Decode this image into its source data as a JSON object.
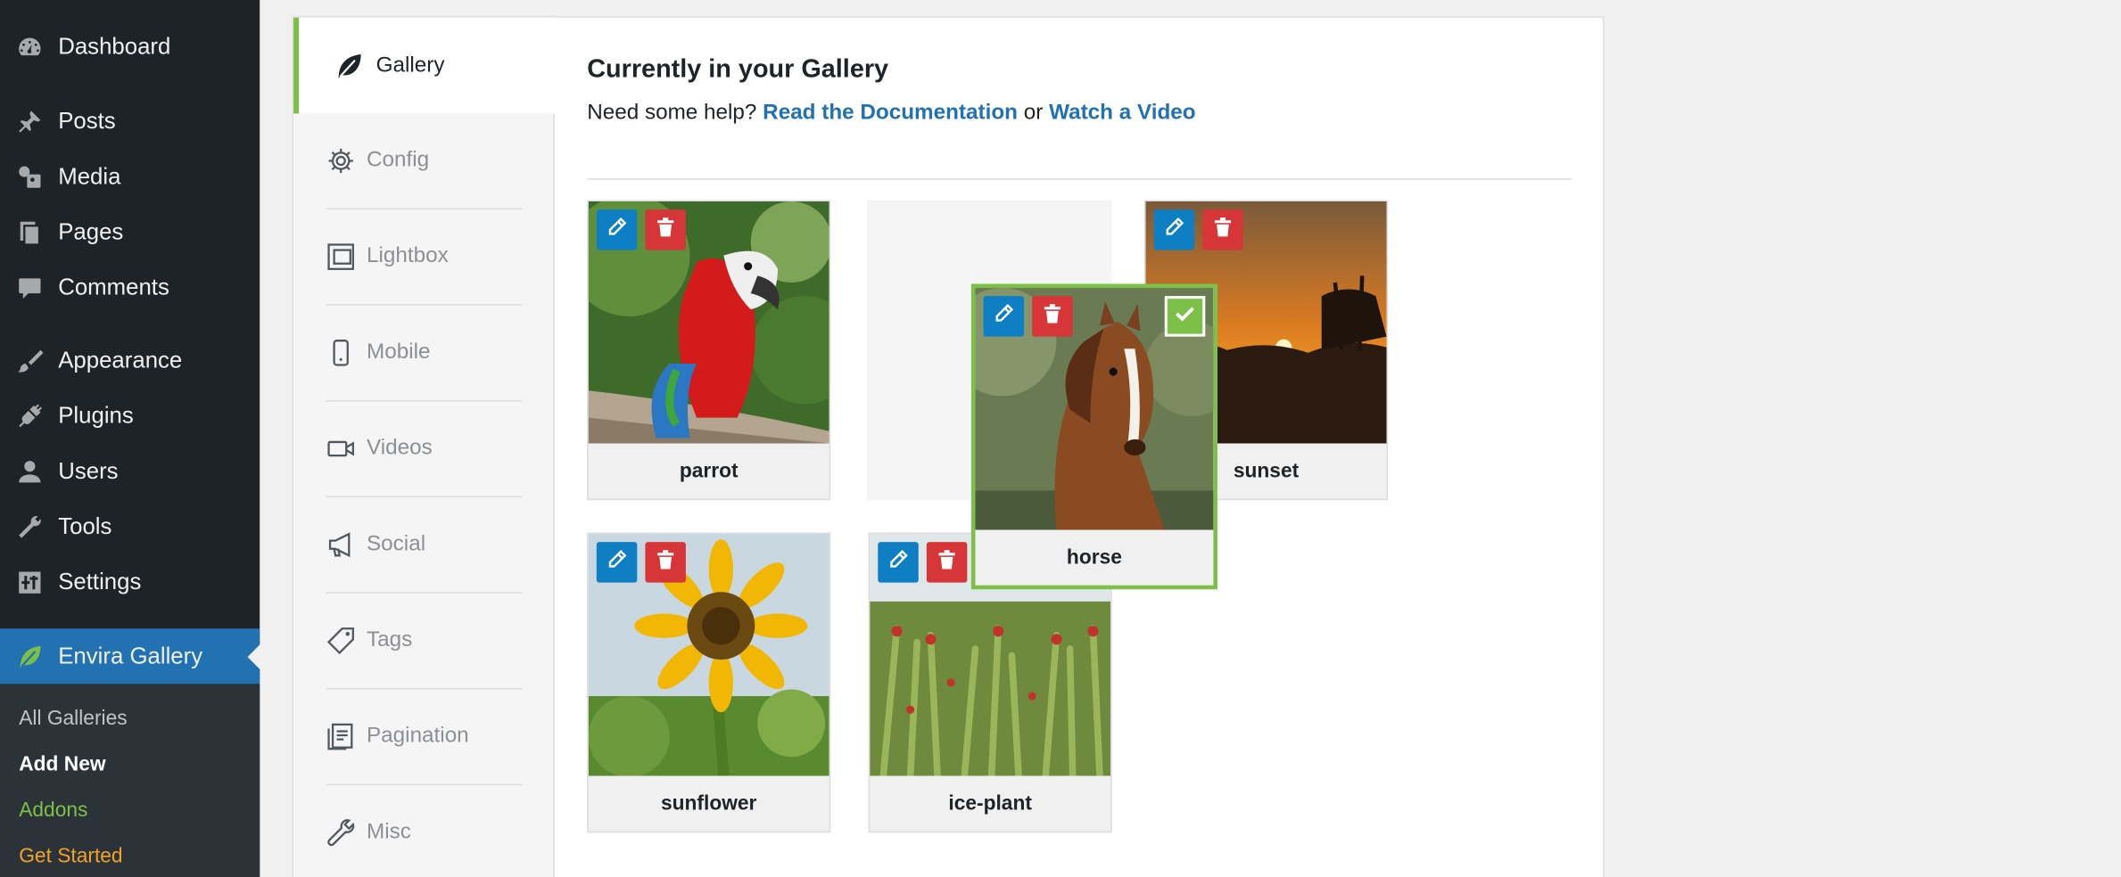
{
  "sidebar": {
    "items": [
      {
        "label": "Dashboard",
        "icon": "dashboard-icon"
      },
      {
        "label": "Posts",
        "icon": "pin-icon"
      },
      {
        "label": "Media",
        "icon": "media-icon"
      },
      {
        "label": "Pages",
        "icon": "pages-icon"
      },
      {
        "label": "Comments",
        "icon": "comment-icon"
      },
      {
        "label": "Appearance",
        "icon": "brush-icon"
      },
      {
        "label": "Plugins",
        "icon": "plug-icon"
      },
      {
        "label": "Users",
        "icon": "user-icon"
      },
      {
        "label": "Tools",
        "icon": "wrench-icon"
      },
      {
        "label": "Settings",
        "icon": "settings-icon"
      },
      {
        "label": "Envira Gallery",
        "icon": "leaf-icon"
      }
    ],
    "submenu": [
      {
        "label": "All Galleries",
        "color": "#c3c4c7"
      },
      {
        "label": "Add New",
        "color": "#ffffff"
      },
      {
        "label": "Addons",
        "color": "#7cc048"
      },
      {
        "label": "Get Started",
        "color": "#f0a32b"
      }
    ]
  },
  "tabs": [
    {
      "label": "Gallery",
      "icon": "leaf-icon",
      "active": true
    },
    {
      "label": "Config",
      "icon": "gear-icon"
    },
    {
      "label": "Lightbox",
      "icon": "lightbox-icon"
    },
    {
      "label": "Mobile",
      "icon": "mobile-icon"
    },
    {
      "label": "Videos",
      "icon": "video-icon"
    },
    {
      "label": "Social",
      "icon": "megaphone-icon"
    },
    {
      "label": "Tags",
      "icon": "tag-icon"
    },
    {
      "label": "Pagination",
      "icon": "pagination-icon"
    },
    {
      "label": "Misc",
      "icon": "wrench-icon"
    }
  ],
  "main": {
    "heading": "Currently in your Gallery",
    "help_text": "Need some help?",
    "doc_link": "Read the Documentation",
    "or_text": "or",
    "video_link": "Watch a Video"
  },
  "gallery": {
    "items": [
      {
        "caption": "parrot"
      },
      {
        "caption": "sunset"
      },
      {
        "caption": "sunflower"
      },
      {
        "caption": "ice-plant"
      }
    ],
    "dragging": {
      "caption": "horse",
      "selected": true
    }
  },
  "colors": {
    "accent": "#7cc048",
    "edit": "#0f7fc4",
    "delete": "#d63638",
    "wp_blue": "#2271b1"
  }
}
